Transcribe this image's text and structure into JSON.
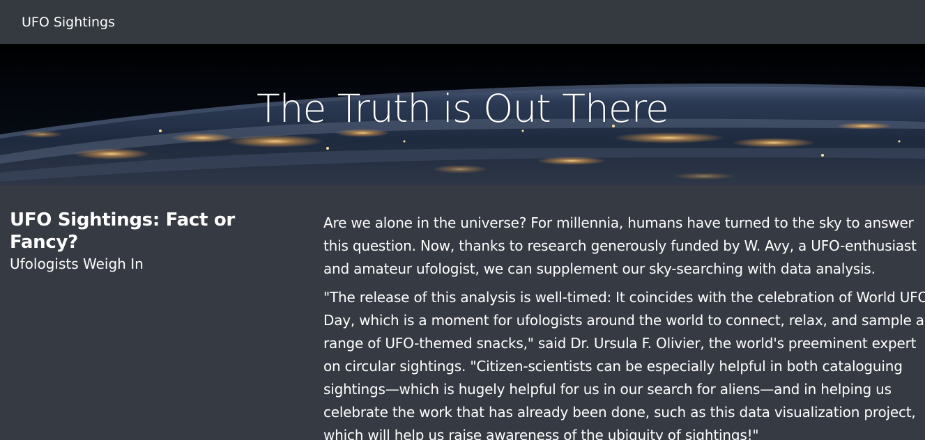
{
  "navbar": {
    "brand": "UFO Sightings"
  },
  "hero": {
    "title": "The Truth is Out There"
  },
  "article": {
    "title": "UFO Sightings: Fact or Fancy?",
    "subtitle": "Ufologists Weigh In",
    "paragraphs": [
      "Are we alone in the universe? For millennia, humans have turned to the sky to answer this question. Now, thanks to research generously funded by W. Avy, a UFO-enthusiast and amateur ufologist, we can supplement our sky-searching with data analysis.",
      "\"The release of this analysis is well-timed: It coincides with the celebration of World UFO Day, which is a moment for ufologists around the world to connect, relax, and sample a range of UFO-themed snacks,\" said Dr. Ursula F. Olivier, the world's preeminent expert on circular sightings. \"Citizen-scientists can be especially helpful in both cataloguing sightings—which is hugely helpful for us in our search for aliens—and in helping us celebrate the work that has already been done, such as this data visualization project, which will help us raise awareness of the ubiquity of sightings!\""
    ]
  },
  "colors": {
    "page_background": "#363a42",
    "navbar_background": "#343a40",
    "text": "#ffffff"
  }
}
